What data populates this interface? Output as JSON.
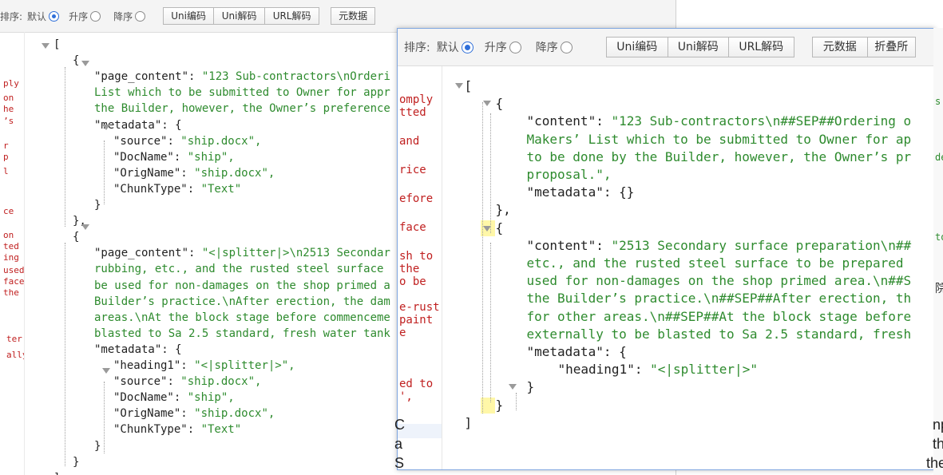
{
  "toolbar": {
    "sort_label": "排序:",
    "sort_label_cut": "排序:",
    "default_label": "默认",
    "asc_label": "升序",
    "desc_label": "降序",
    "uni_encode": "Uni编码",
    "uni_decode": "Uni解码",
    "url_decode": "URL解码",
    "metadata_btn": "元数据",
    "metadata_btn_cut": "元数据",
    "fold_all": "折叠所"
  },
  "back_window": {
    "side_fragments": [
      "ply",
      "on",
      "he",
      "’s",
      "r",
      "p",
      "l",
      "ce",
      "on",
      "ted",
      "ing",
      "used",
      "face",
      "the",
      "ter",
      "ally"
    ],
    "json_lines": [
      "[",
      "{",
      "\"page_content\": \"123 Sub-contractors\\nOrderi",
      "List which to be submitted to Owner for appr",
      "the Builder, however, the Owner’s preference",
      "\"metadata\": {",
      "\"source\": \"ship.docx\",",
      "\"DocName\": \"ship\",",
      "\"OrigName\": \"ship.docx\",",
      "\"ChunkType\": \"Text\"",
      "}",
      "},",
      "{",
      "\"page_content\": \"<|splitter|>\\n2513 Secondar",
      "rubbing, etc., and the rusted steel surface",
      "be used for non-damages on the shop primed a",
      "Builder’s practice.\\nAfter erection, the dam",
      "areas.\\nAt the block stage before commenceme",
      "blasted to Sa 2.5 standard, fresh water tank",
      "\"metadata\": {",
      "\"heading1\": \"<|splitter|>\",",
      "\"source\": \"ship.docx\",",
      "\"DocName\": \"ship\",",
      "\"OrigName\": \"ship.docx\",",
      "\"ChunkType\": \"Text\"",
      "}",
      "}",
      "]"
    ]
  },
  "front_window": {
    "side_fragments": [
      "omply",
      "tted",
      "and",
      "rice",
      "efore",
      "face",
      "sh to",
      "the",
      "o be",
      "e-rust",
      "paint",
      "e",
      "ed to",
      "',"
    ],
    "json_lines": [
      "[",
      "{",
      "\"content\": \"123 Sub-contractors\\n##SEP##Ordering o",
      "Makers’ List which to be submitted to Owner for ap",
      "to be done by the Builder, however, the Owner’s pr",
      "proposal.\",",
      "\"metadata\": {}",
      "},",
      "{",
      "\"content\": \"2513 Secondary surface preparation\\n##",
      "etc., and the rusted steel surface to be prepared",
      "used for non-damages on the shop primed area.\\n##S",
      "the Builder’s practice.\\n##SEP##After erection, th",
      "for other areas.\\n##SEP##At the block stage before",
      "externally to be blasted to Sa 2.5 standard, fresh",
      "\"metadata\": {",
      "\"heading1\": \"<|splitter|>\"",
      "}",
      "}",
      "]"
    ]
  },
  "right_edge_fragments": [
    "s",
    "de",
    "to",
    "院"
  ],
  "bottom_fragments": [
    "C",
    "a",
    "S",
    "np",
    "th",
    "the"
  ],
  "colors": {
    "string": "#2e8b2e",
    "key": "#222222",
    "red_text": "#c02020",
    "highlight": "#fff7a8",
    "radio_selected": "#2f6fd9",
    "window_border": "#7fa6e0"
  }
}
